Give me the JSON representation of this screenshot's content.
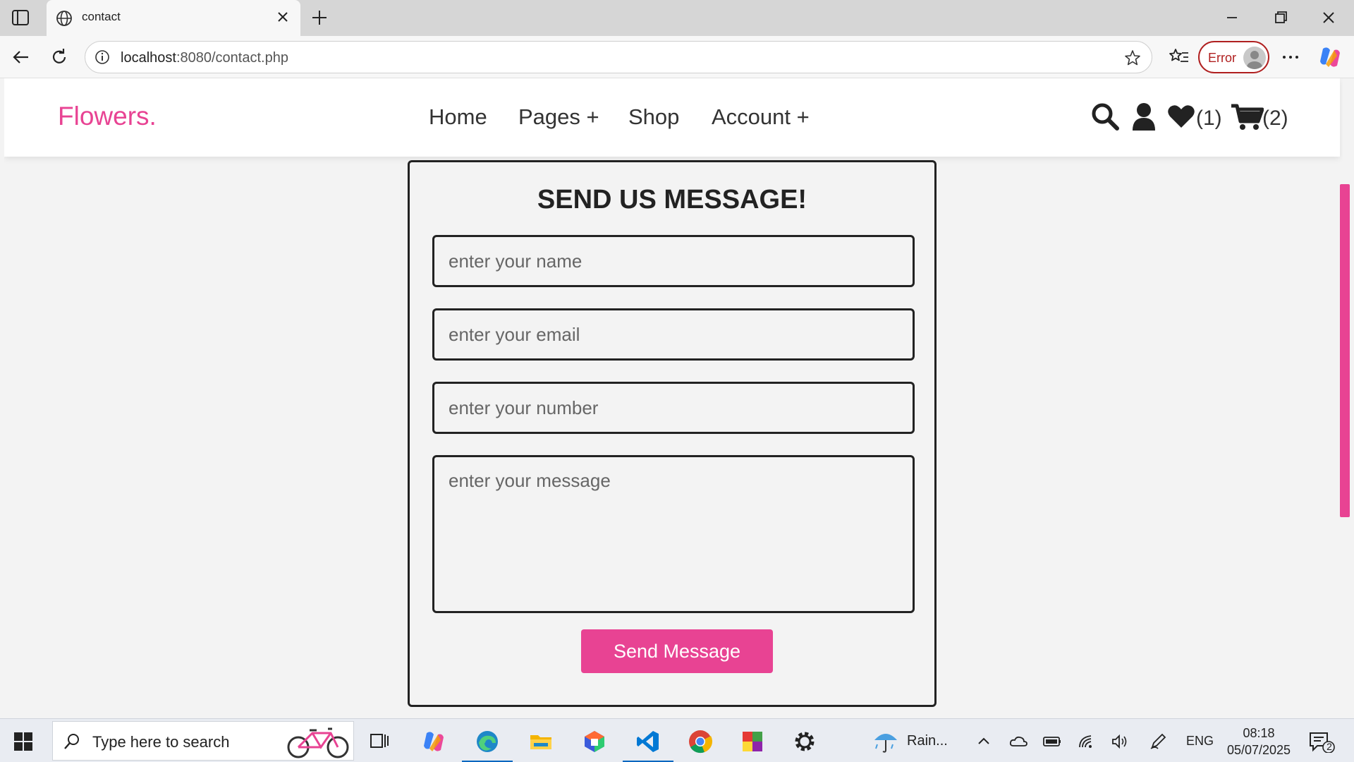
{
  "browser": {
    "tab_title": "contact",
    "url_host": "localhost",
    "url_path": ":8080/contact.php",
    "error_label": "Error"
  },
  "site": {
    "logo": "Flowers.",
    "nav": [
      {
        "label": "Home"
      },
      {
        "label": "Pages +"
      },
      {
        "label": "Shop"
      },
      {
        "label": "Account +"
      }
    ],
    "wishlist_count": "(1)",
    "cart_count": "(2)",
    "accent_color": "#e84393"
  },
  "form": {
    "heading": "SEND US MESSAGE!",
    "name_placeholder": "enter your name",
    "email_placeholder": "enter your email",
    "number_placeholder": "enter your number",
    "message_placeholder": "enter your message",
    "submit_label": "Send Message"
  },
  "taskbar": {
    "search_placeholder": "Type here to search",
    "weather": "Rain...",
    "language": "ENG",
    "time": "08:18",
    "date": "05/07/2025",
    "notification_count": "2"
  }
}
